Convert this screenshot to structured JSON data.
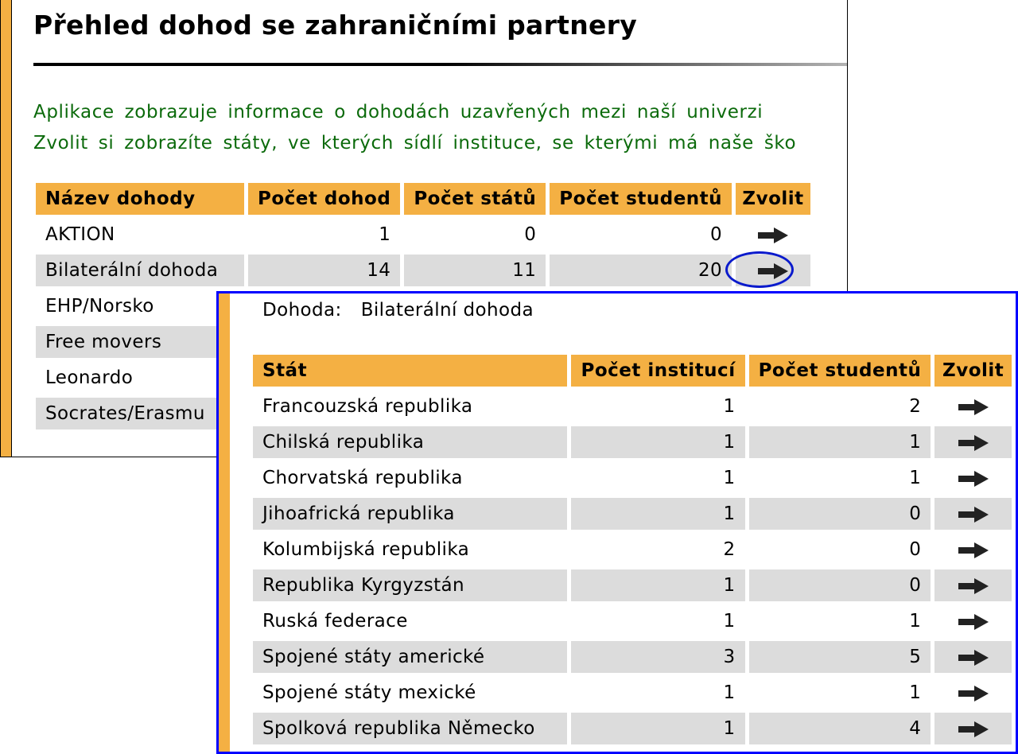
{
  "page": {
    "title": "Přehled dohod se zahraničními partnery",
    "intro_lines": [
      "Aplikace zobrazuje informace o dohodách uzavřených mezi naší univerzi",
      "Zvolit si zobrazíte státy, ve kterých sídlí instituce, se kterými má naše ško"
    ]
  },
  "agreements_table": {
    "headers": [
      "Název dohody",
      "Počet dohod",
      "Počet států",
      "Počet studentů",
      "Zvolit"
    ],
    "rows": [
      {
        "name": "AKTION",
        "dohody": "1",
        "staty": "0",
        "studenti": "0",
        "select_icon": "arrow-right-icon"
      },
      {
        "name": "Bilaterální dohoda",
        "dohody": "14",
        "staty": "11",
        "studenti": "20",
        "select_icon": "arrow-right-icon",
        "highlighted": true
      },
      {
        "name": "EHP/Norsko"
      },
      {
        "name": "Free movers"
      },
      {
        "name": "Leonardo"
      },
      {
        "name": "Socrates/Erasmu"
      }
    ]
  },
  "detail": {
    "dohoda_label": "Dohoda:",
    "dohoda_value": "Bilaterální dohoda",
    "headers": [
      "Stát",
      "Počet institucí",
      "Počet studentů",
      "Zvolit"
    ],
    "rows": [
      {
        "stat": "Francouzská republika",
        "instituce": "1",
        "studenti": "2"
      },
      {
        "stat": "Chilská republika",
        "instituce": "1",
        "studenti": "1"
      },
      {
        "stat": "Chorvatská republika",
        "instituce": "1",
        "studenti": "1"
      },
      {
        "stat": "Jihoafrická republika",
        "instituce": "1",
        "studenti": "0"
      },
      {
        "stat": "Kolumbijská republika",
        "instituce": "2",
        "studenti": "0"
      },
      {
        "stat": "Republika Kyrgyzstán",
        "instituce": "1",
        "studenti": "0"
      },
      {
        "stat": "Ruská federace",
        "instituce": "1",
        "studenti": "1"
      },
      {
        "stat": "Spojené státy americké",
        "instituce": "3",
        "studenti": "5"
      },
      {
        "stat": "Spojené státy mexické",
        "instituce": "1",
        "studenti": "1"
      },
      {
        "stat": "Spolková republika Německo",
        "instituce": "1",
        "studenti": "4"
      }
    ]
  },
  "colors": {
    "accent_orange": "#f4b043",
    "intro_green": "#0b6a0b",
    "overlay_border_blue": "#0000ff",
    "alt_row_gray": "#dcdcdc"
  }
}
